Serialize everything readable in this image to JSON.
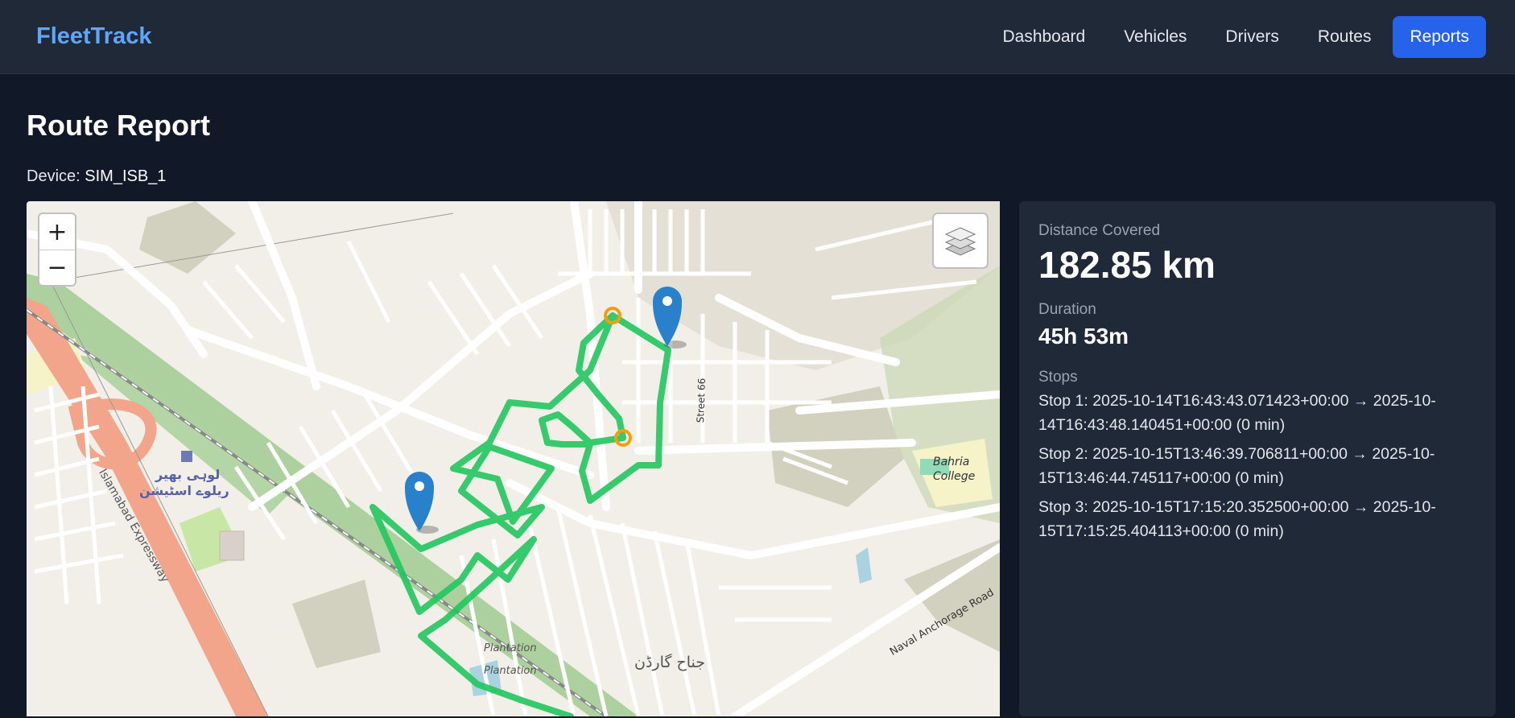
{
  "nav": {
    "brand": "FleetTrack",
    "links": [
      "Dashboard",
      "Vehicles",
      "Drivers",
      "Routes",
      "Reports"
    ],
    "active": "Reports"
  },
  "page": {
    "title": "Route Report",
    "device_label": "Device:",
    "device_value": "SIM_ISB_1"
  },
  "map": {
    "zoom_in": "+",
    "zoom_out": "−",
    "labels": {
      "expressway": "Islamabad Expressway",
      "station_line1": "لوہی بھیر",
      "station_line2": "ریلوے اسٹیشن",
      "street66": "Street 66",
      "college_line1": "Bahria",
      "college_line2": "College",
      "naval_road": "Naval Anchorage Road",
      "plantation1": "Plantation",
      "plantation2": "Plantation",
      "jinnah_garden": "جناح گارڈن"
    },
    "route_color": "#22c55e",
    "stop_marker_color": "#f59e0b",
    "pin_color": "#2a81cb",
    "layers_icon": "layers-icon"
  },
  "stats": {
    "distance_label": "Distance Covered",
    "distance_value": "182.85 km",
    "duration_label": "Duration",
    "duration_value": "45h 53m",
    "stops_label": "Stops",
    "stops": [
      "Stop 1: 2025-10-14T16:43:43.071423+00:00 → 2025-10-14T16:43:48.140451+00:00 (0 min)",
      "Stop 2: 2025-10-15T13:46:39.706811+00:00 → 2025-10-15T13:46:44.745117+00:00 (0 min)",
      "Stop 3: 2025-10-15T17:15:20.352500+00:00 → 2025-10-15T17:15:25.404113+00:00 (0 min)"
    ]
  }
}
